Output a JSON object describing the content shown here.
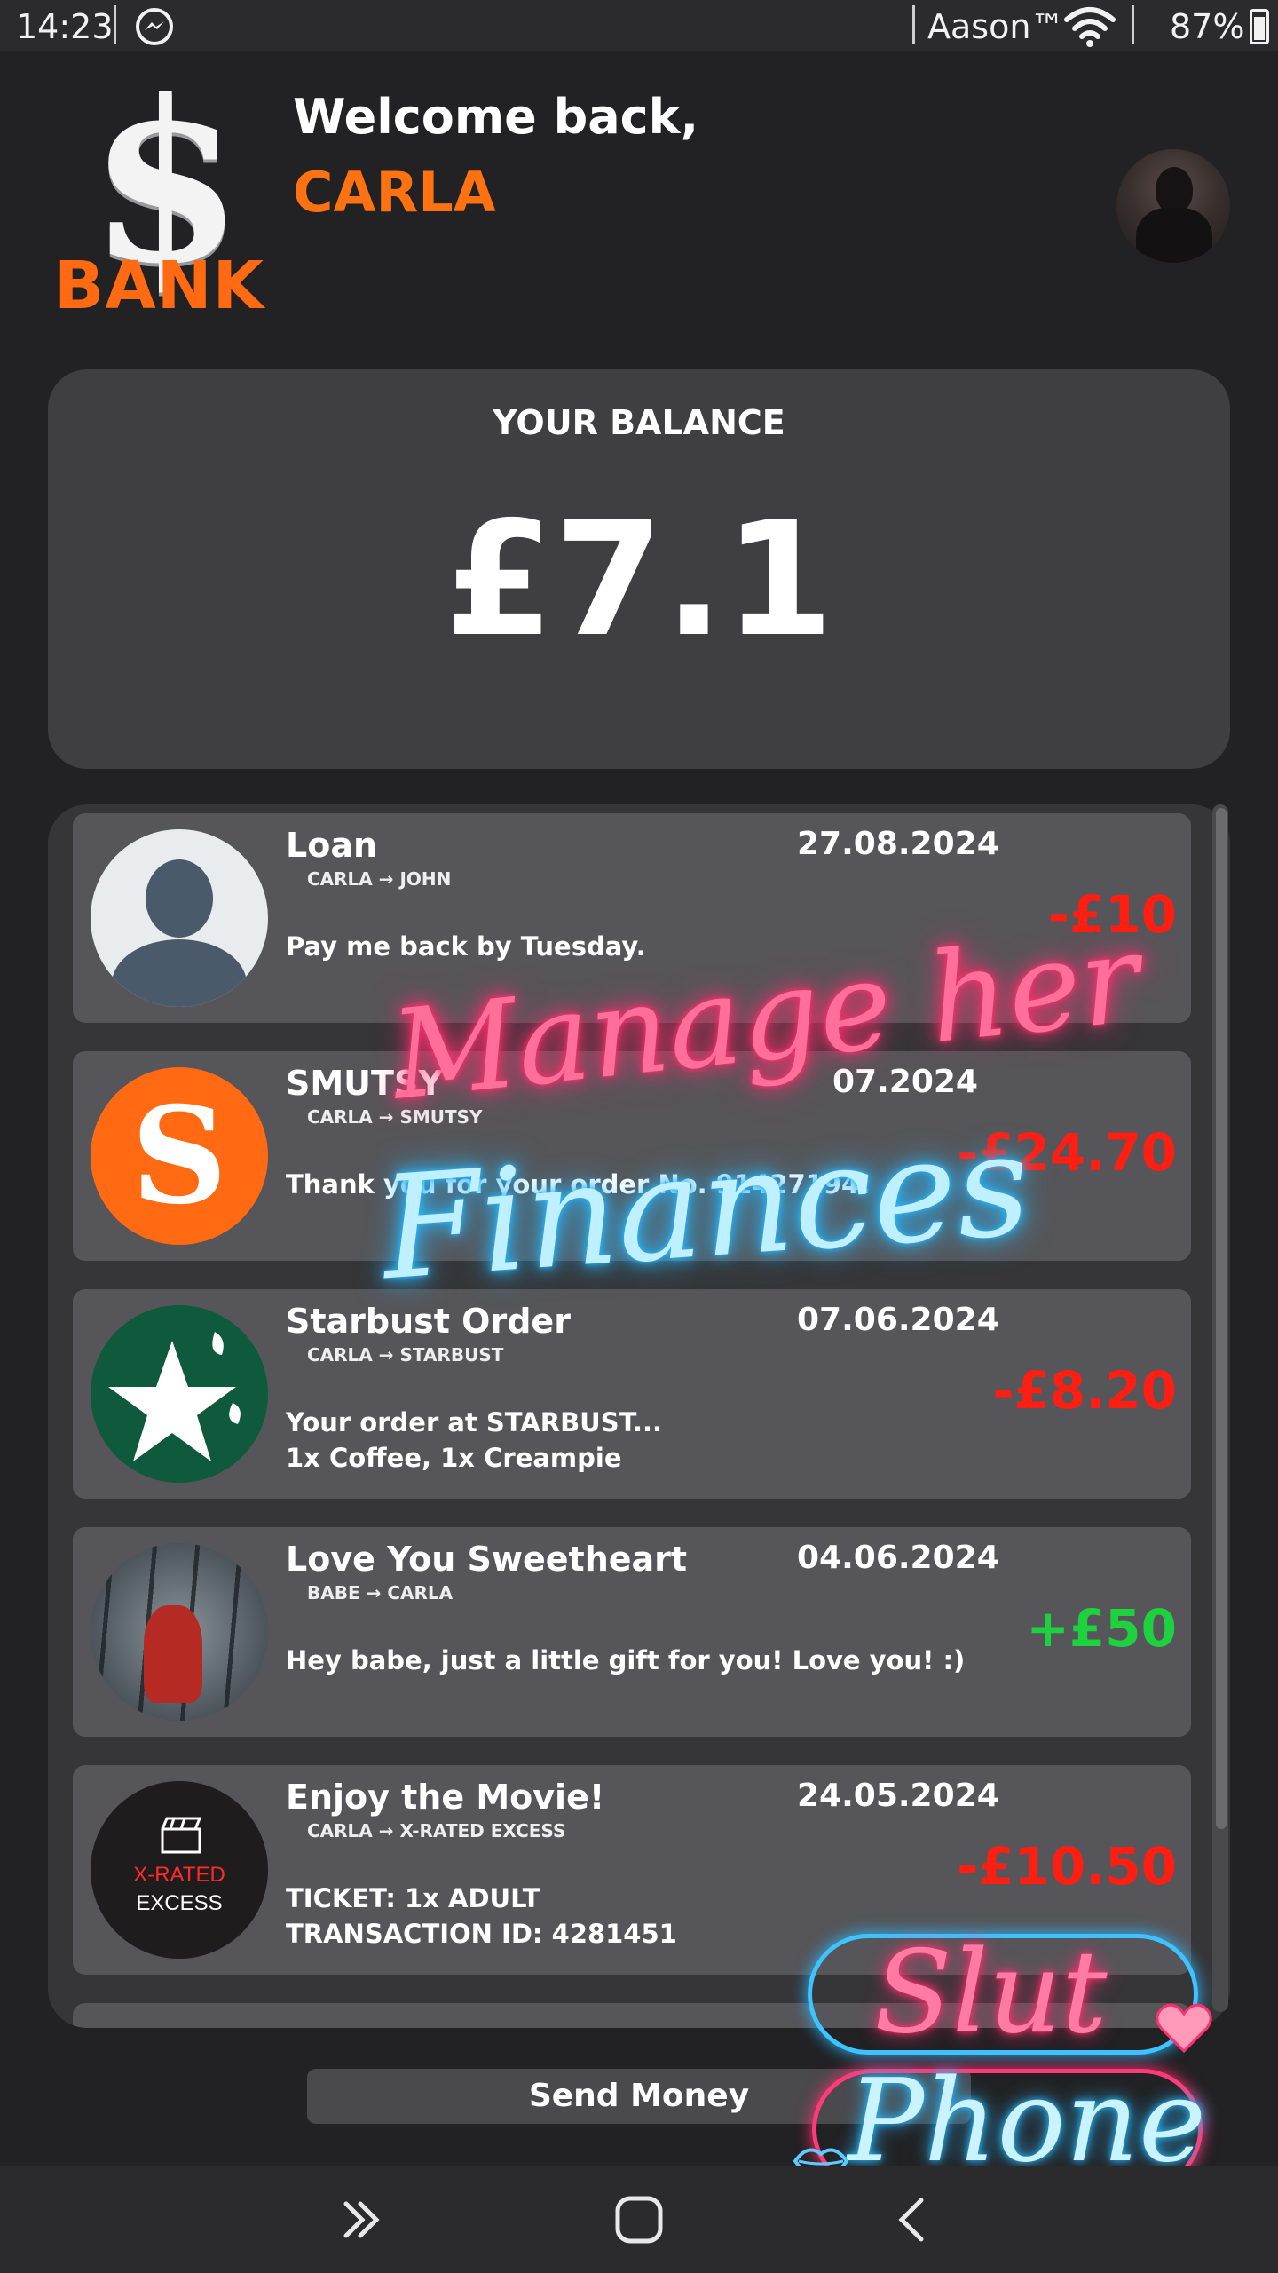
{
  "status_bar": {
    "time": "14:23",
    "carrier": "Aason™",
    "battery": "87%"
  },
  "header": {
    "logo_text": "BANK",
    "welcome": "Welcome back,",
    "username": "CARLA"
  },
  "balance": {
    "label": "YOUR BALANCE",
    "value": "£7.1"
  },
  "transactions": [
    {
      "title": "Loan",
      "route": "CARLA → JOHN",
      "date": "27.08.2024",
      "desc_lines": [
        "Pay me back by Tuesday."
      ],
      "amount": "-£10",
      "icon": "person-placeholder-icon"
    },
    {
      "title": "SMUTSY",
      "route": "CARLA → SMUTSY",
      "date": "07.2024",
      "desc_lines": [
        "Thank you for your order No. 91427194!"
      ],
      "amount": "-£24.70",
      "icon": "smutsy-logo-icon"
    },
    {
      "title": "Starbust Order",
      "route": "CARLA → STARBUST",
      "date": "07.06.2024",
      "desc_lines": [
        "Your order at STARBUST...",
        "1x Coffee, 1x Creampie"
      ],
      "amount": "-£8.20",
      "icon": "starbust-logo-icon"
    },
    {
      "title": "Love You Sweetheart",
      "route": "BABE → CARLA",
      "date": "04.06.2024",
      "desc_lines": [
        "Hey babe, just a little gift for you! Love you! :)"
      ],
      "amount": "+£50",
      "icon": "profile-photo-icon"
    },
    {
      "title": "Enjoy the Movie!",
      "route": "CARLA → X-RATED EXCESS",
      "date": "24.05.2024",
      "desc_lines": [
        "TICKET: 1x ADULT",
        "TRANSACTION ID: 4281451"
      ],
      "amount": "-£10.50",
      "icon": "x-rated-excess-logo-icon",
      "icon_text": [
        "X-RATED",
        "EXCESS"
      ]
    }
  ],
  "overlay": {
    "line1": "Manage her",
    "line2": "Finances"
  },
  "send_button": "Send Money",
  "watermark": {
    "word1": "Slut",
    "word2": "Phone"
  },
  "colors": {
    "accent": "#ff6a13",
    "negative": "#ff1e12",
    "positive": "#1ed13f",
    "background": "#222123",
    "card": "#3f3e41"
  }
}
